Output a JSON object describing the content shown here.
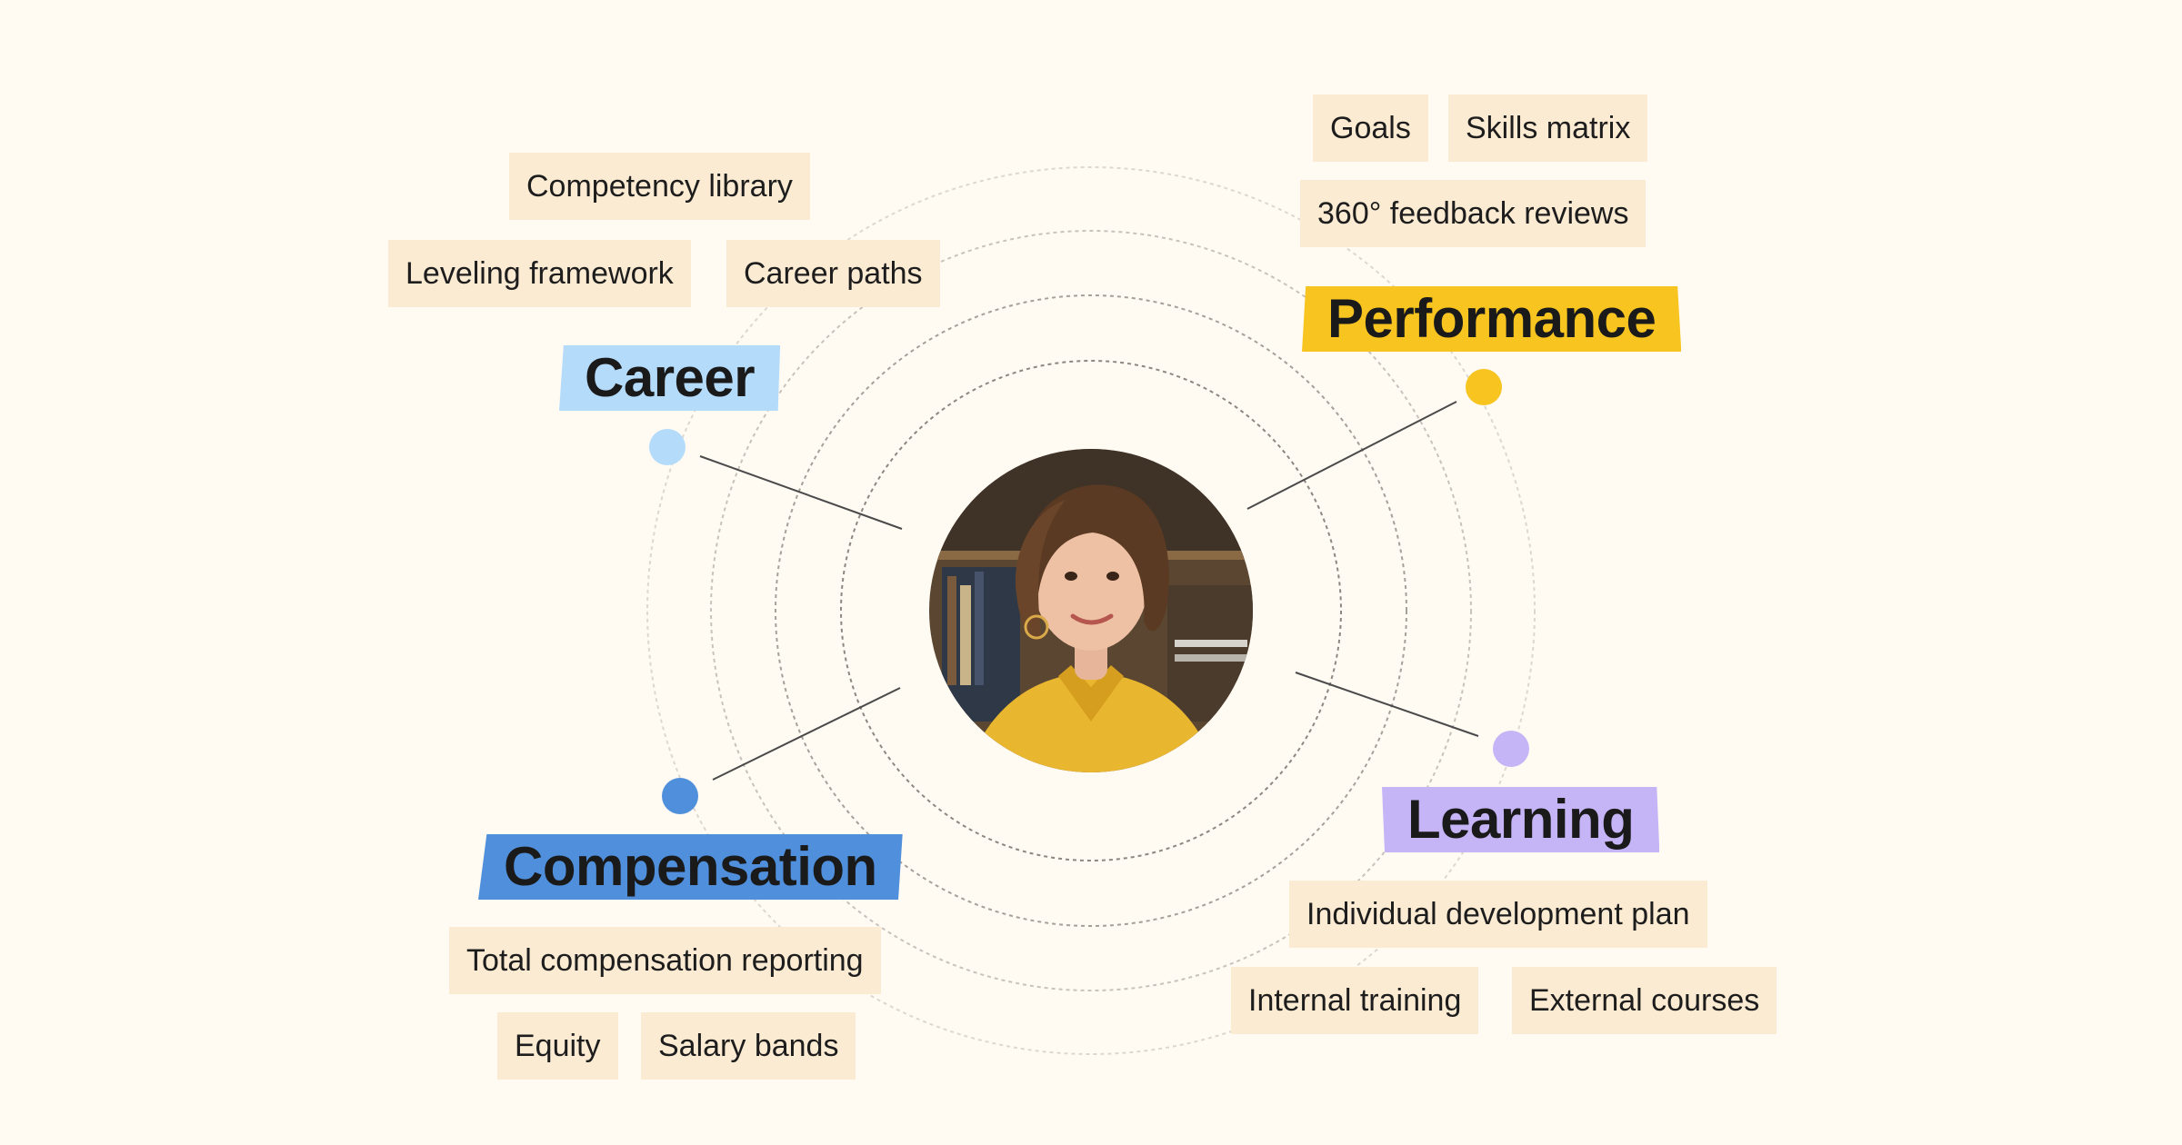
{
  "colors": {
    "background": "#fffaf2",
    "chip": "#fcebd3",
    "career": "#b5dbfb",
    "performance": "#f8c420",
    "compensation": "#4f8fdc",
    "learning": "#c6b5f6"
  },
  "categories": {
    "career": {
      "label": "Career",
      "items": [
        "Competency library",
        "Leveling framework",
        "Career paths"
      ]
    },
    "performance": {
      "label": "Performance",
      "items": [
        "Goals",
        "Skills matrix",
        "360° feedback reviews"
      ]
    },
    "compensation": {
      "label": "Compensation",
      "items": [
        "Total compensation reporting",
        "Equity",
        "Salary bands"
      ]
    },
    "learning": {
      "label": "Learning",
      "items": [
        "Individual development plan",
        "Internal training",
        "External courses"
      ]
    }
  },
  "center": {
    "image": "portrait-of-smiling-woman"
  }
}
